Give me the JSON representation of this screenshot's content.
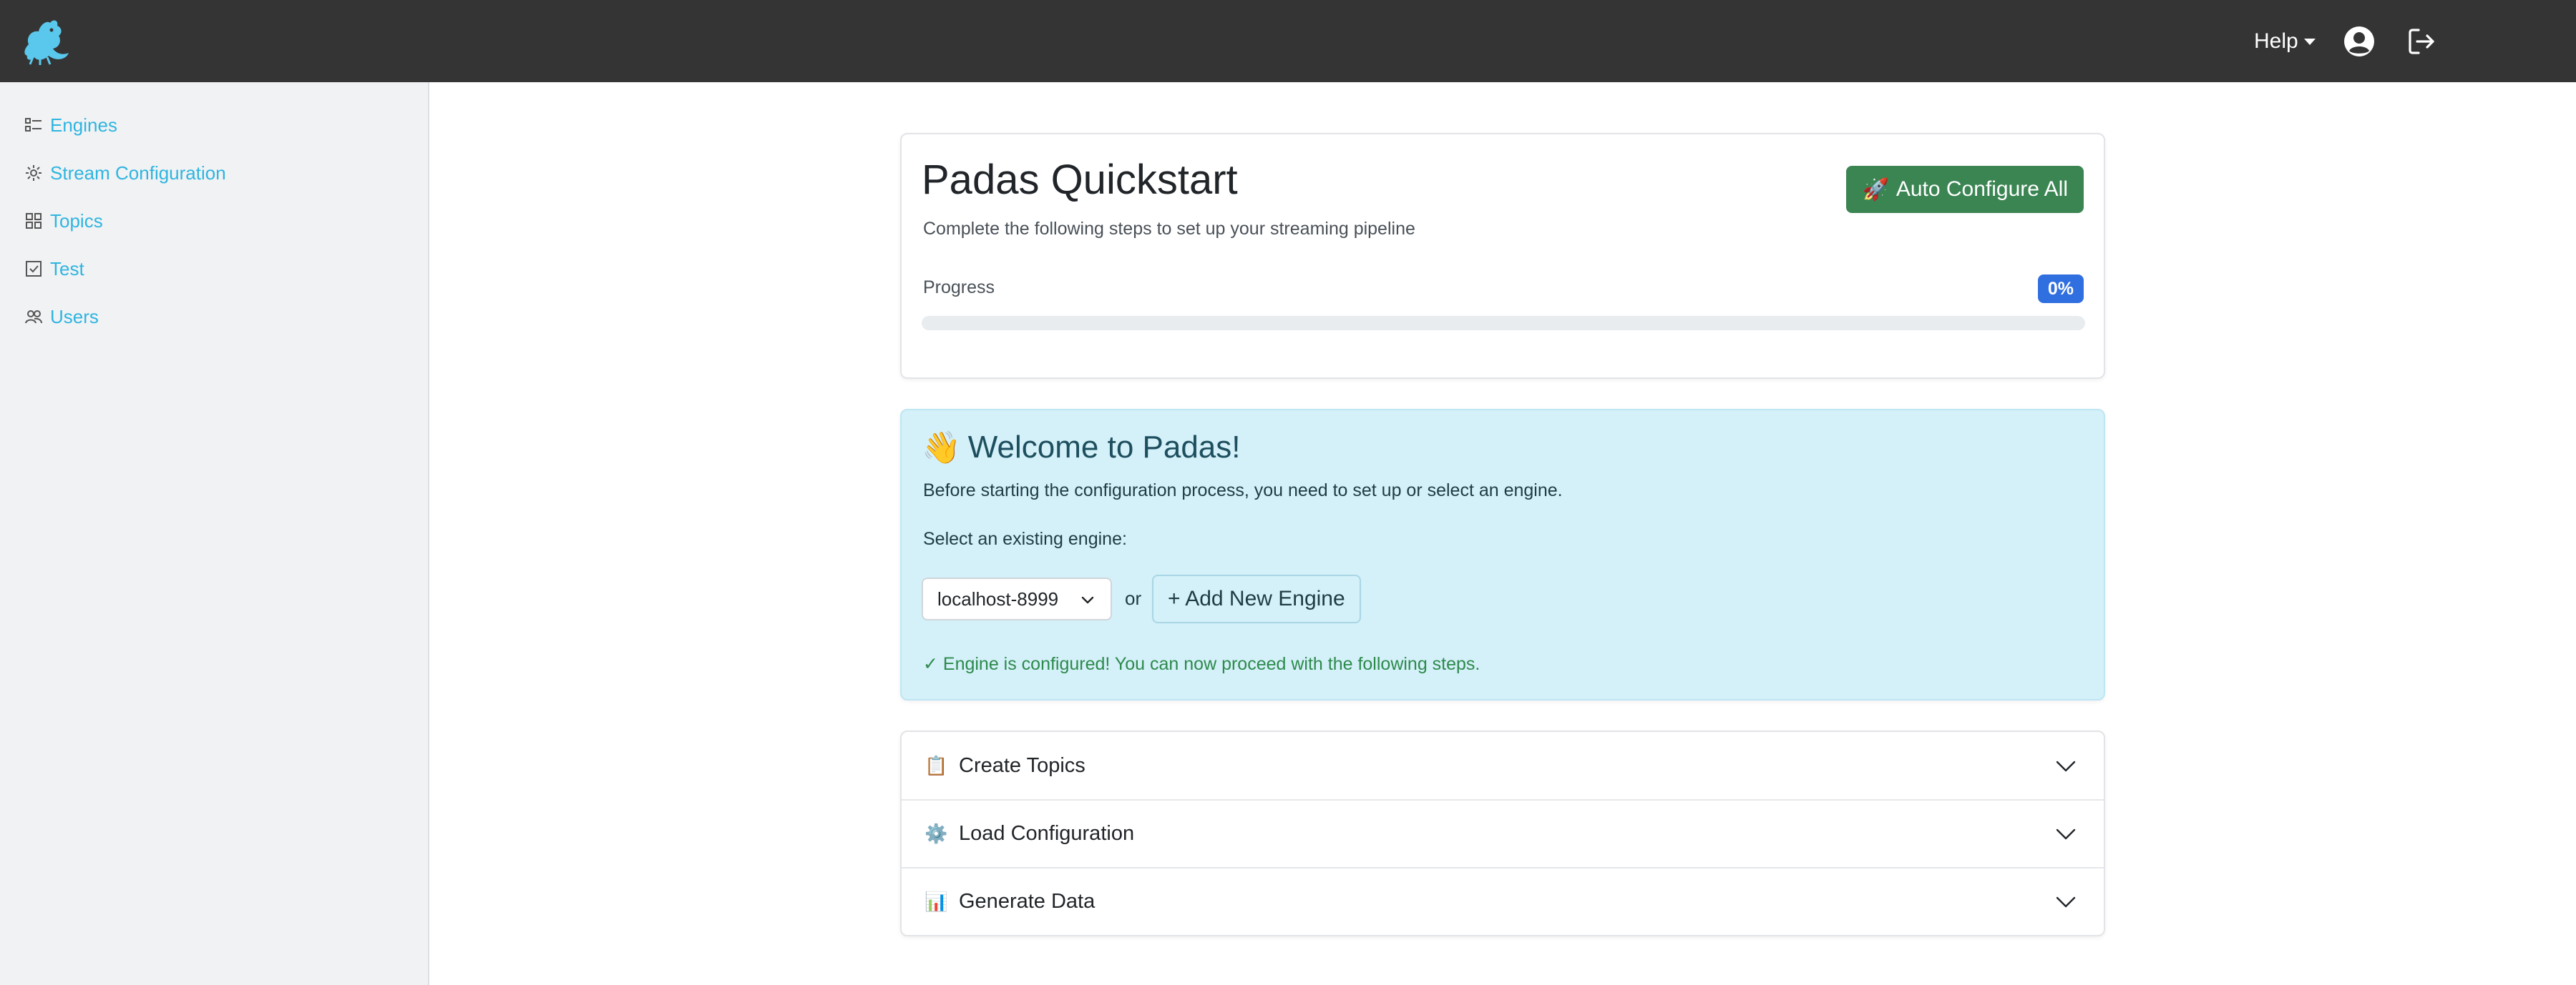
{
  "app": {
    "logo_icon": "dragon-logo-icon"
  },
  "topbar": {
    "help_label": "Help",
    "user_icon": "user-circle-icon",
    "logout_icon": "logout-icon"
  },
  "sidebar": {
    "items": [
      {
        "label": "Engines",
        "icon": "list-check-icon"
      },
      {
        "label": "Stream Configuration",
        "icon": "gear-icon"
      },
      {
        "label": "Topics",
        "icon": "grid-icon"
      },
      {
        "label": "Test",
        "icon": "checkbox-icon"
      },
      {
        "label": "Users",
        "icon": "users-icon"
      }
    ]
  },
  "quickstart": {
    "title": "Padas Quickstart",
    "subtitle": "Complete the following steps to set up your streaming pipeline",
    "auto_button_emoji": "🚀",
    "auto_button_label": "Auto Configure All",
    "progress_label": "Progress",
    "progress_badge": "0%",
    "progress_value": 0
  },
  "welcome": {
    "emoji": "👋",
    "title": "Welcome to Padas!",
    "text": "Before starting the configuration process, you need to set up or select an engine.",
    "select_label": "Select an existing engine:",
    "selected_engine": "localhost-8999",
    "or_text": "or",
    "add_engine_label": "+ Add New Engine",
    "configured_text": "✓ Engine is configured! You can now proceed with the following steps."
  },
  "steps": [
    {
      "emoji": "📋",
      "label": "Create Topics"
    },
    {
      "emoji": "⚙️",
      "label": "Load Configuration"
    },
    {
      "emoji": "📊",
      "label": "Generate Data"
    }
  ],
  "colors": {
    "topbar": "#343434",
    "sidebar_link": "#2fb5e0",
    "auto_button": "#3b8553",
    "badge": "#2f6fe0",
    "welcome_bg": "#d4f0f9",
    "success_text": "#2d8a4b"
  }
}
